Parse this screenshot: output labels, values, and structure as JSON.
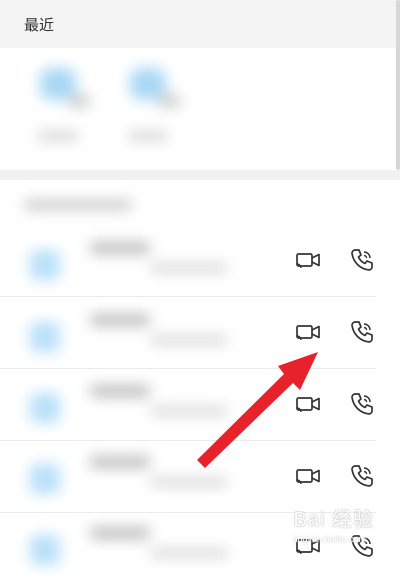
{
  "header": {
    "title": "最近"
  },
  "contacts": [
    {
      "video_icon": "video-call-icon",
      "voice_icon": "phone-call-icon"
    },
    {
      "video_icon": "video-call-icon",
      "voice_icon": "phone-call-icon"
    },
    {
      "video_icon": "video-call-icon",
      "voice_icon": "phone-call-icon"
    },
    {
      "video_icon": "video-call-icon",
      "voice_icon": "phone-call-icon"
    },
    {
      "video_icon": "video-call-icon",
      "voice_icon": "phone-call-icon"
    }
  ],
  "annotation": {
    "arrow_color": "#e8222a"
  },
  "watermark": {
    "text": "Bai 经验",
    "sub": "jingyan.baidu.com"
  },
  "colors": {
    "icon": "#333333",
    "header_bg": "#f3f3f3"
  }
}
